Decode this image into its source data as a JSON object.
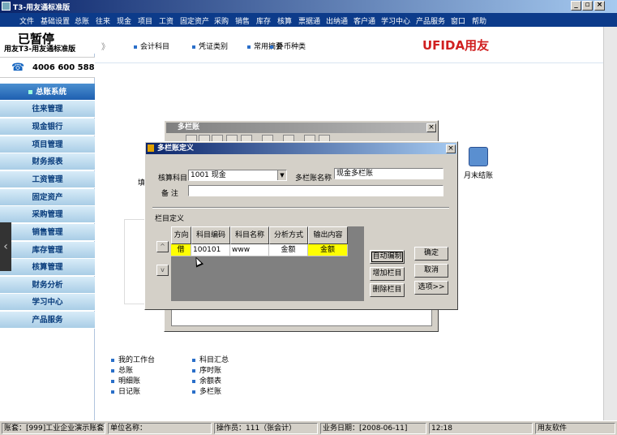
{
  "window": {
    "title": "T3-用友通标准版",
    "minimize": "_",
    "restore": "▫",
    "close": "×"
  },
  "menu": [
    "文件",
    "基础设置",
    "总账",
    "往来",
    "现金",
    "项目",
    "工资",
    "固定资产",
    "采购",
    "销售",
    "库存",
    "核算",
    "票据通",
    "出纳通",
    "客户通",
    "学习中心",
    "产品服务",
    "窗口",
    "帮助"
  ],
  "brand": {
    "text": "用友T3-用友通标准版",
    "stamp": "已暂停",
    "phone": "4006 600 588"
  },
  "nav": {
    "items": [
      "总账系统",
      "往来管理",
      "现金银行",
      "项目管理",
      "财务报表",
      "工资管理",
      "固定资产",
      "采购管理",
      "销售管理",
      "库存管理",
      "核算管理",
      "财务分析",
      "学习中心",
      "产品服务"
    ],
    "active_index": 0
  },
  "quick": {
    "arrows": "》",
    "links": [
      "会计科目",
      "凭证类别",
      "常用摘要",
      "外币种类"
    ],
    "logo": "UFIDA用友"
  },
  "workspace": {
    "left_label": "填",
    "month_end": "月末结账"
  },
  "bottom_links": {
    "col1": [
      "我的工作台",
      "总账",
      "明细账",
      "日记账"
    ],
    "col2": [
      "科目汇总",
      "序时账",
      "余额表",
      "多栏账"
    ]
  },
  "back_dialog": {
    "title": "多栏账"
  },
  "dialog": {
    "title": "多栏账定义",
    "account_label": "核算科目",
    "account_value": "1001 现金",
    "name_label": "多栏账名称",
    "name_value": "现金多栏账",
    "remark_label": "备  注",
    "remark_value": "",
    "group_label": "栏目定义",
    "columns": [
      "方向",
      "科目编码",
      "科目名称",
      "分析方式",
      "输出内容"
    ],
    "rows": [
      [
        "借",
        "100101",
        "www",
        "金额",
        "金额"
      ]
    ],
    "buttons_mid": [
      "自动编制",
      "增加栏目",
      "删除栏目"
    ],
    "buttons_right": [
      "确定",
      "取消",
      "选项>>"
    ],
    "up": "^",
    "down": "v"
  },
  "status": {
    "account": "账套：[999]工业企业演示账套",
    "unit": "单位名称：",
    "operator": "操作员：111（张会计）",
    "business_date": "业务日期：[2008-06-11]",
    "time": "12:18",
    "vendor": "用友软件"
  }
}
